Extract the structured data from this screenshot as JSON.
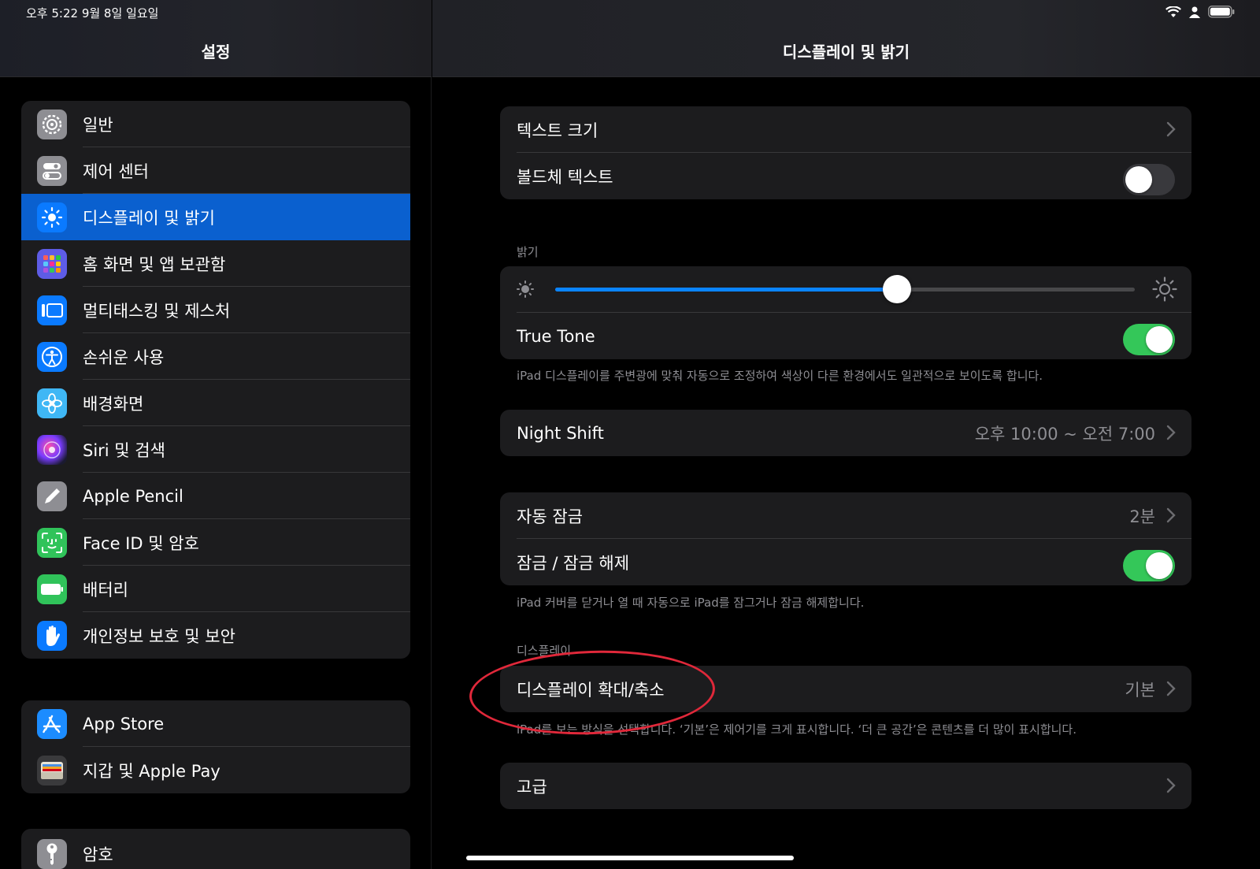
{
  "status": {
    "time": "오후 5:22   9월 8일 일요일"
  },
  "sidebar": {
    "title": "설정",
    "group1": [
      {
        "label": "일반",
        "icon": "gear-icon",
        "color": "#8e8e93"
      },
      {
        "label": "제어 센터",
        "icon": "switches-icon",
        "color": "#8e8e93"
      },
      {
        "label": "디스플레이 및 밝기",
        "icon": "sun-icon",
        "color": "#0a7aff",
        "selected": true
      },
      {
        "label": "홈 화면 및 앱 보관함",
        "icon": "app-grid-icon",
        "color": "#5e5ce6"
      },
      {
        "label": "멀티태스킹 및 제스처",
        "icon": "multitask-icon",
        "color": "#0a7aff"
      },
      {
        "label": "손쉬운 사용",
        "icon": "accessibility-icon",
        "color": "#0a7aff"
      },
      {
        "label": "배경화면",
        "icon": "flower-icon",
        "color": "#3fb7f5"
      },
      {
        "label": "Siri 및 검색",
        "icon": "siri-icon",
        "color": "#222"
      },
      {
        "label": "Apple Pencil",
        "icon": "pencil-icon",
        "color": "#8e8e93"
      },
      {
        "label": "Face ID 및 암호",
        "icon": "faceid-icon",
        "color": "#30c35a"
      },
      {
        "label": "배터리",
        "icon": "battery-icon",
        "color": "#30c35a"
      },
      {
        "label": "개인정보 보호 및 보안",
        "icon": "hand-icon",
        "color": "#0a7aff"
      }
    ],
    "group2": [
      {
        "label": "App Store",
        "icon": "appstore-icon",
        "color": "#1c8cff"
      },
      {
        "label": "지갑 및 Apple Pay",
        "icon": "wallet-icon",
        "color": "#3a3a3c"
      }
    ],
    "group3": [
      {
        "label": "암호",
        "icon": "key-icon",
        "color": "#8e8e93"
      }
    ]
  },
  "detail": {
    "title": "디스플레이 및 밝기",
    "text_size": "텍스트 크기",
    "bold_text": "볼드체 텍스트",
    "bold_text_on": false,
    "brightness_header": "밝기",
    "brightness_level": 0.59,
    "true_tone": "True Tone",
    "true_tone_on": true,
    "true_tone_caption": "iPad 디스플레이를 주변광에 맞춰 자동으로 조정하여 색상이 다른 환경에서도 일관적으로 보이도록 합니다.",
    "night_shift": "Night Shift",
    "night_shift_value": "오후 10:00 ~ 오전 7:00",
    "auto_lock": "자동 잠금",
    "auto_lock_value": "2분",
    "lock_unlock": "잠금 / 잠금 해제",
    "lock_unlock_on": true,
    "lock_caption": "iPad 커버를 닫거나 열 때 자동으로 iPad를 잠그거나 잠금 해제합니다.",
    "display_header": "디스플레이",
    "display_zoom": "디스플레이 확대/축소",
    "display_zoom_value": "기본",
    "zoom_caption": "iPad를 보는 방식을 선택합니다. ‘기본’은 제어기를 크게 표시합니다. ‘더 큰 공간’은 콘텐츠를 더 많이 표시합니다.",
    "advanced": "고급"
  },
  "colors": {
    "accent": "#0a84ff",
    "selected": "#0a60cf",
    "toggle_on": "#34c759",
    "annotation": "#e0283a"
  }
}
